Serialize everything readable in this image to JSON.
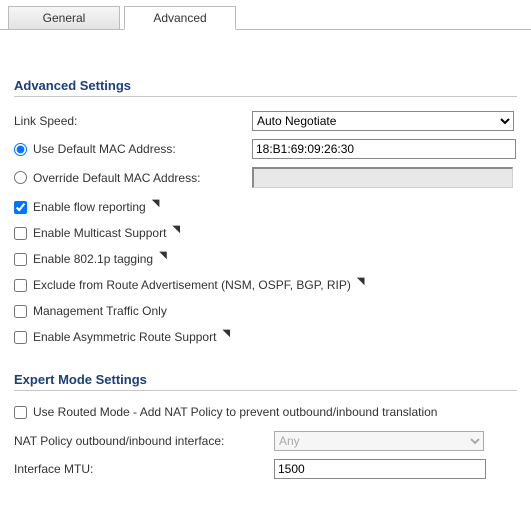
{
  "tabs": {
    "general": "General",
    "advanced": "Advanced"
  },
  "sections": {
    "advanced": "Advanced Settings",
    "expert": "Expert Mode Settings"
  },
  "linkspeed": {
    "label": "Link Speed:",
    "value": "Auto Negotiate"
  },
  "mac": {
    "use_default_label": "Use Default MAC Address:",
    "override_label": "Override Default MAC Address:",
    "default_value": "18:B1:69:09:26:30"
  },
  "checks": {
    "flow": "Enable flow reporting",
    "multicast": "Enable Multicast Support",
    "dot1p": "Enable 802.1p tagging",
    "exclude_route": "Exclude from Route Advertisement (NSM, OSPF, BGP, RIP)",
    "mgmt_only": "Management Traffic Only",
    "asym_route": "Enable Asymmetric Route Support"
  },
  "expert": {
    "routed_mode": "Use Routed Mode - Add NAT Policy to prevent outbound/inbound translation",
    "nat_label": "NAT Policy outbound/inbound interface:",
    "nat_value": "Any",
    "mtu_label": "Interface MTU:",
    "mtu_value": "1500"
  }
}
